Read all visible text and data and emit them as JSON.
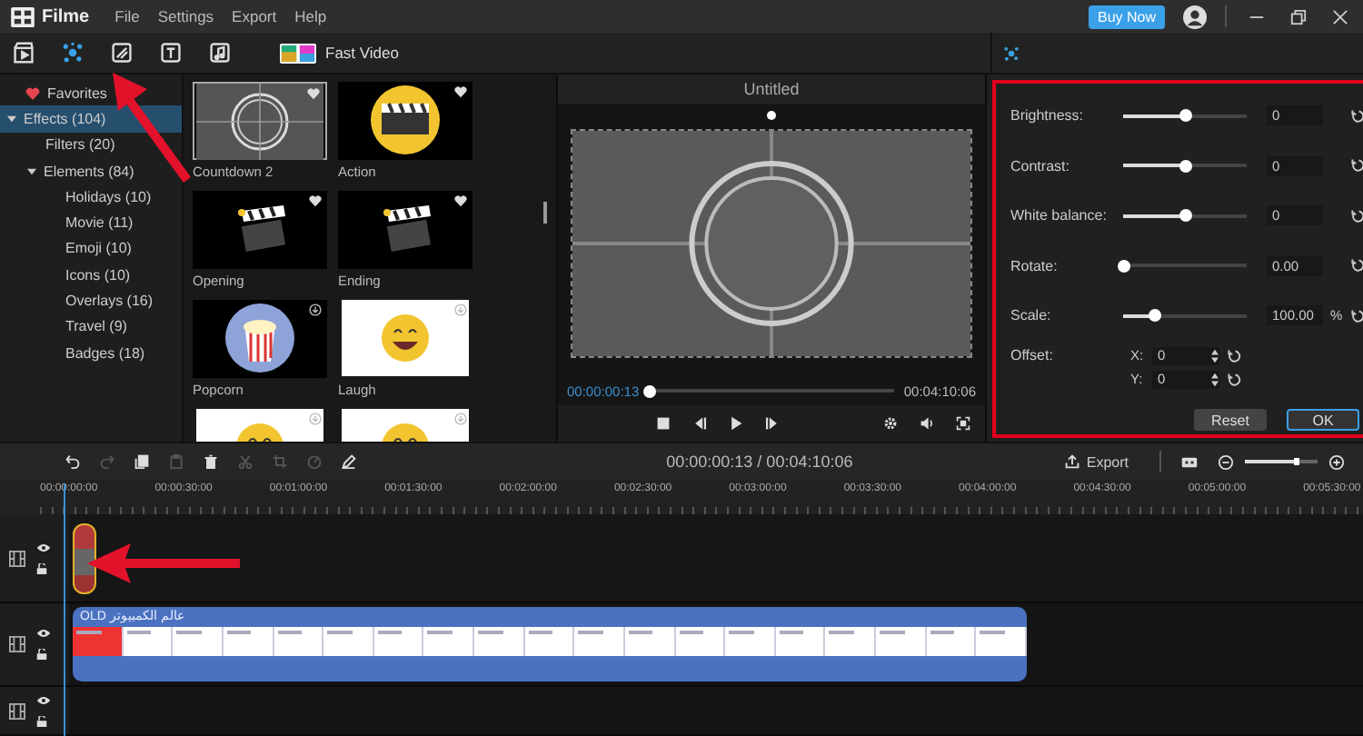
{
  "app": {
    "name": "Filme",
    "menu": [
      "File",
      "Settings",
      "Export",
      "Help"
    ],
    "buy_button": "Buy Now"
  },
  "tabs": [
    {
      "kind": "media",
      "selected": false
    },
    {
      "kind": "effects",
      "selected": true
    },
    {
      "kind": "transition",
      "selected": false
    },
    {
      "kind": "text",
      "selected": false
    },
    {
      "kind": "music",
      "selected": false
    },
    {
      "kind": "fast",
      "label": "Fast Video",
      "selected": false
    }
  ],
  "sidebar": {
    "items": [
      {
        "label": "Favorites",
        "kind": "favorites",
        "selected": false
      },
      {
        "label": "Effects (104)",
        "selected": true,
        "expanded": true,
        "children": [
          {
            "label": "Filters (20)",
            "selected": false
          },
          {
            "label": "Elements (84)",
            "selected": false,
            "expanded": true,
            "children": [
              {
                "label": "Holidays (10)",
                "selected": false
              },
              {
                "label": "Movie (11)",
                "selected": false
              },
              {
                "label": "Emoji (10)",
                "selected": false
              },
              {
                "label": "Icons (10)",
                "selected": false
              },
              {
                "label": "Overlays (16)",
                "selected": false
              },
              {
                "label": "Travel (9)",
                "selected": false
              },
              {
                "label": "Badges (18)",
                "selected": false
              }
            ]
          }
        ]
      }
    ]
  },
  "media": [
    {
      "label": "Countdown 2",
      "kind": "countdown",
      "downloaded": true,
      "selected": true
    },
    {
      "label": "Action",
      "kind": "clapper-circle",
      "downloaded": true,
      "selected": false
    },
    {
      "label": "Opening",
      "kind": "clapper",
      "downloaded": true,
      "selected": false
    },
    {
      "label": "Ending",
      "kind": "clapper",
      "downloaded": true,
      "selected": false
    },
    {
      "label": "Popcorn",
      "kind": "popcorn",
      "downloaded": false,
      "selected": false
    },
    {
      "label": "Laugh",
      "kind": "emoji",
      "downloaded": false,
      "selected": false
    },
    {
      "kind": "emoji",
      "downloaded": false,
      "selected": false
    },
    {
      "kind": "emoji",
      "downloaded": false,
      "selected": false
    }
  ],
  "preview": {
    "title": "Untitled",
    "current_time": "00:00:00:13",
    "total_time": "00:04:10:06",
    "progress": {
      "level": 0.01
    },
    "volume_on": true
  },
  "adjust": {
    "rows": [
      {
        "label": "Brightness:",
        "kind": "slider",
        "level": 0.5,
        "value": "0"
      },
      {
        "label": "Contrast:",
        "kind": "slider",
        "level": 0.5,
        "value": "0"
      },
      {
        "label": "White balance:",
        "kind": "slider",
        "level": 0.5,
        "value": "0"
      },
      {
        "label": "Rotate:",
        "kind": "slider",
        "level": 0,
        "value": "0.00"
      },
      {
        "label": "Scale:",
        "kind": "slider",
        "level": 0.25,
        "value": "100.00",
        "unit": "%"
      },
      {
        "label": "Offset:",
        "kind": "offset",
        "x_label": "X:",
        "x_value": "0",
        "y_label": "Y:",
        "y_value": "0"
      }
    ],
    "buttons": [
      {
        "label": "Reset",
        "selected": false
      },
      {
        "label": "OK",
        "selected": true
      }
    ]
  },
  "timeline": {
    "tools": [
      {
        "kind": "undo",
        "disabled": false
      },
      {
        "kind": "redo",
        "disabled": true
      },
      {
        "kind": "copy",
        "disabled": false
      },
      {
        "kind": "paste",
        "disabled": true
      },
      {
        "kind": "delete",
        "disabled": false
      },
      {
        "kind": "cut",
        "disabled": true
      },
      {
        "kind": "crop",
        "disabled": true
      },
      {
        "kind": "speed",
        "disabled": true
      },
      {
        "kind": "pen",
        "disabled": false
      }
    ],
    "time": "00:00:00:13 / 00:04:10:06",
    "export": "Export",
    "zoom": {
      "level": 0.7
    },
    "ruler": [
      "00:00:00:00",
      "00:00:30:00",
      "00:01:00:00",
      "00:01:30:00",
      "00:02:00:00",
      "00:02:30:00",
      "00:03:00:00",
      "00:03:30:00",
      "00:04:00:00",
      "00:04:30:00",
      "00:05:00:00",
      "00:05:30:00"
    ],
    "tracks": [
      {
        "kind": "effect",
        "locked": false
      },
      {
        "kind": "video",
        "locked": false,
        "clip": "OLD عالم الكمبيوتر"
      },
      {
        "kind": "video",
        "locked": false
      }
    ]
  }
}
